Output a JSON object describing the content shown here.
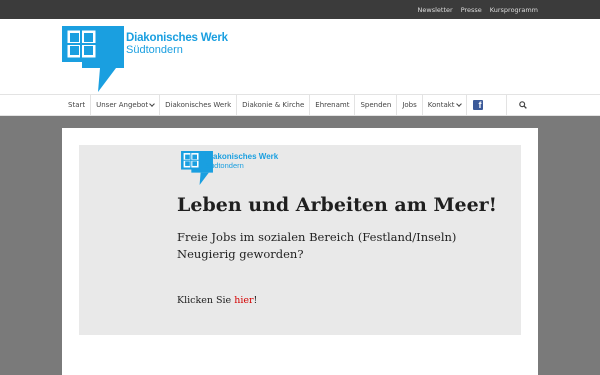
{
  "topbar": {
    "links": [
      "Newsletter",
      "Presse",
      "Kursprogramm"
    ]
  },
  "logo": {
    "line1": "Diakonisches Werk",
    "line2": "Südtondern",
    "color": "#1a9fe0"
  },
  "nav": {
    "items": [
      {
        "label": "Start",
        "dropdown": false
      },
      {
        "label": "Unser Angebot",
        "dropdown": true
      },
      {
        "label": "Diakonisches Werk",
        "dropdown": false
      },
      {
        "label": "Diakonie & Kirche",
        "dropdown": false
      },
      {
        "label": "Ehrenamt",
        "dropdown": false
      },
      {
        "label": "Spenden",
        "dropdown": false
      },
      {
        "label": "Jobs",
        "dropdown": false
      },
      {
        "label": "Kontakt",
        "dropdown": true
      }
    ],
    "icons": [
      "facebook-icon",
      "search-icon"
    ]
  },
  "banner": {
    "logo_line1": "Diakonisches Werk",
    "logo_line2": "Südtondern",
    "headline": "Leben und Arbeiten am Meer!",
    "sub_line1": "Freie Jobs im sozialen Bereich (Festland/Inseln)",
    "sub_line2": "Neugierig geworden?",
    "cta_prefix": "Klicken Sie ",
    "cta_link": "hier",
    "cta_suffix": "!",
    "link_color": "#d40000"
  }
}
